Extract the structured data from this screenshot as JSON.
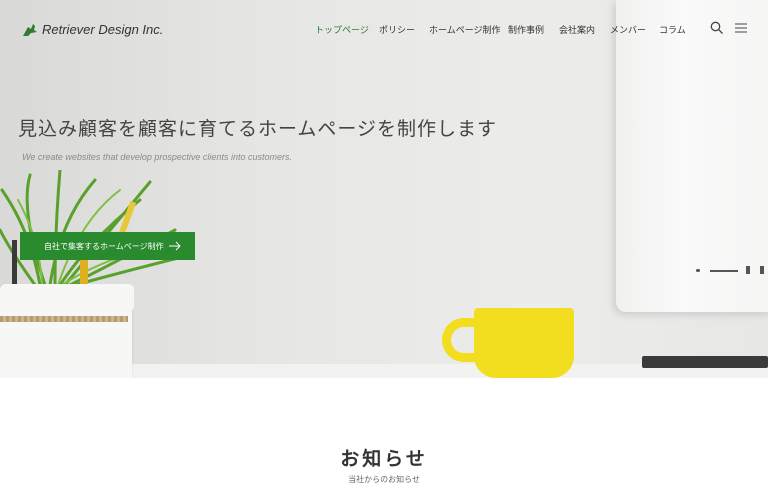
{
  "brand": {
    "name": "Retriever Design Inc.",
    "accent": "#2e7d32"
  },
  "nav": {
    "items": [
      {
        "label": "トップページ",
        "active": true
      },
      {
        "label": "ポリシー",
        "active": false
      },
      {
        "label": "ホームページ制作",
        "active": false
      },
      {
        "label": "制作事例",
        "active": false
      },
      {
        "label": "会社案内",
        "active": false
      },
      {
        "label": "メンバー",
        "active": false
      },
      {
        "label": "コラム",
        "active": false
      }
    ],
    "search_icon": "search-icon",
    "menu_icon": "hamburger-menu-icon"
  },
  "hero": {
    "headline": "見込み顧客を顧客に育てるホームページを制作します",
    "subheadline": "We create websites that develop prospective clients into customers.",
    "cta_label": "自社で集客するホームページ制作",
    "cta_color": "#2a8a2e"
  },
  "news": {
    "title": "お知らせ",
    "subtitle": "当社からのお知らせ"
  }
}
